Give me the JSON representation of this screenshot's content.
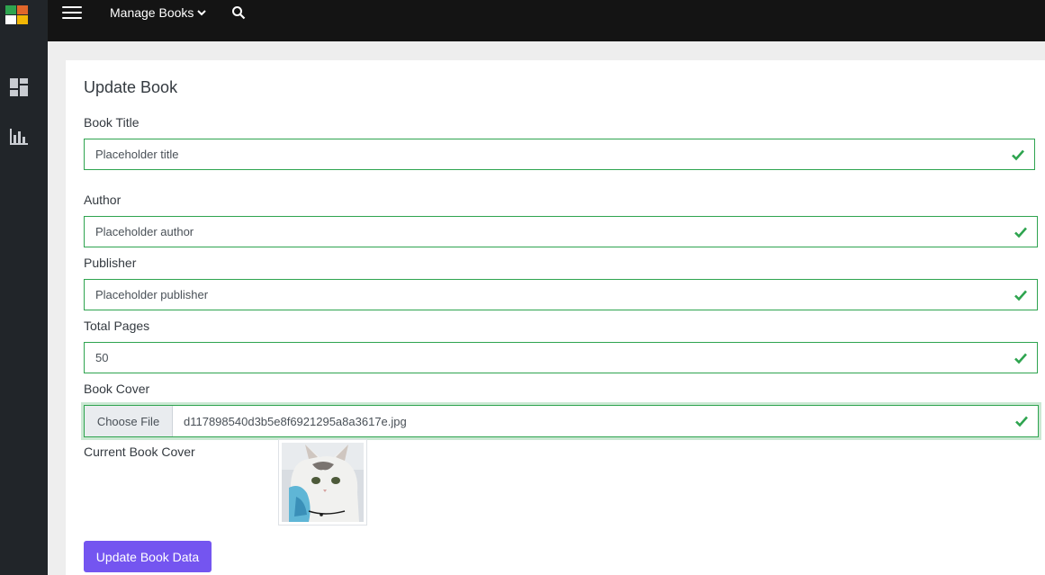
{
  "topbar": {
    "menu_label": "Manage Books"
  },
  "page": {
    "title": "Update Book"
  },
  "form": {
    "title_label": "Book Title",
    "title_value": "Placeholder title",
    "author_label": "Author",
    "author_value": "Placeholder author",
    "publisher_label": "Publisher",
    "publisher_value": "Placeholder publisher",
    "pages_label": "Total Pages",
    "pages_value": "50",
    "cover_label": "Book Cover",
    "choose_file_label": "Choose File",
    "file_name": "d117898540d3b5e8f6921295a8a3617e.jpg",
    "current_cover_label": "Current Book Cover",
    "submit_label": "Update Book Data"
  },
  "icons": {
    "hamburger": "menu-icon",
    "search": "search-icon",
    "dashboard": "dashboard-icon",
    "chart": "bar-chart-icon",
    "valid": "check-icon",
    "cover": "cat-photo"
  },
  "colors": {
    "sidebar_bg": "#212529",
    "topbar_bg": "#141414",
    "valid_green": "#2ea44f",
    "submit_bg": "#7455f0"
  }
}
